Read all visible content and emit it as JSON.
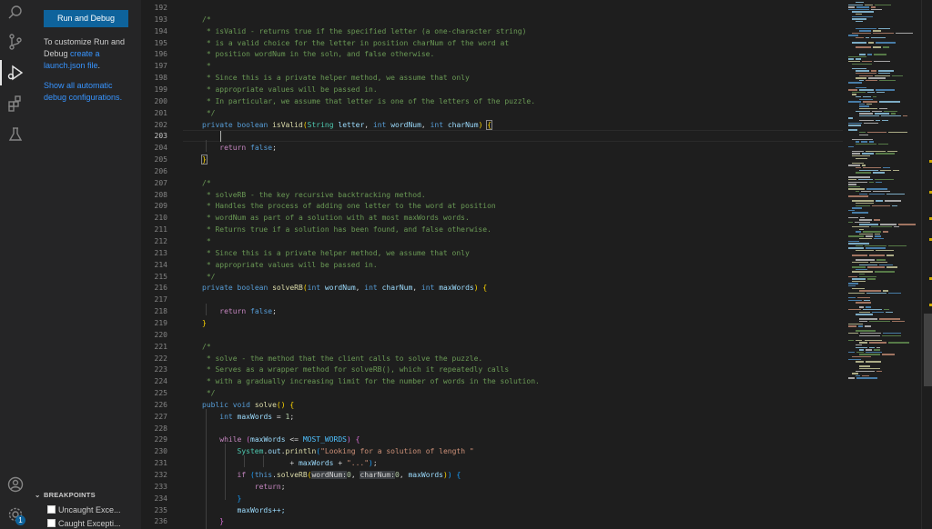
{
  "sidebar": {
    "run_button": "Run and Debug",
    "customize_text": "To customize Run and Debug ",
    "customize_link": "create a launch.json file",
    "customize_end": ".",
    "show_link": "Show all automatic debug configurations",
    "show_end": ".",
    "breakpoints_header": "BREAKPOINTS",
    "breakpoints": [
      {
        "label": "Uncaught Exce..."
      },
      {
        "label": "Caught Excepti..."
      }
    ]
  },
  "activity_bar": {
    "icons": [
      "search-icon",
      "source-control-icon",
      "run-debug-icon",
      "extensions-icon",
      "testing-icon",
      "account-icon",
      "settings-gear-icon"
    ],
    "settings_badge": "1"
  },
  "editor": {
    "colors": {
      "background": "#1e1e1e",
      "comment": "#6a9955",
      "keyword": "#569cd6"
    },
    "line_numbers": [
      "192",
      "193",
      "194",
      "195",
      "196",
      "197",
      "198",
      "199",
      "200",
      "201",
      "202",
      "203",
      "204",
      "205",
      "206",
      "207",
      "208",
      "209",
      "210",
      "211",
      "212",
      "213",
      "214",
      "215",
      "216",
      "217",
      "218",
      "219",
      "220",
      "221",
      "222",
      "223",
      "224",
      "225",
      "226",
      "227",
      "228",
      "229",
      "230",
      "231",
      "232",
      "233",
      "234",
      "235",
      "236"
    ],
    "current_line": "203",
    "text": {
      "c194": " * isValid - returns true if the specified letter (a one-character string)",
      "c195": " * is a valid choice for the letter in position charNum of the word at",
      "c196": " * position wordNum in the soln, and false otherwise.",
      "c197": " *",
      "c198": " * Since this is a private helper method, we assume that only",
      "c199": " * appropriate values will be passed in.",
      "c200": " * In particular, we assume that letter is one of the letters of the puzzle.",
      "c201": " */",
      "c208": " * solveRB - the key recursive backtracking method.",
      "c209": " * Handles the process of adding one letter to the word at position",
      "c210": " * wordNum as part of a solution with at most maxWords words.",
      "c211": " * Returns true if a solution has been found, and false otherwise.",
      "c212": " *",
      "c213": " * Since this is a private helper method, we assume that only",
      "c214": " * appropriate values will be passed in.",
      "c215": " */",
      "c222": " * solve - the method that the client calls to solve the puzzle.",
      "c223": " * Serves as a wrapper method for solveRB(), which it repeatedly calls",
      "c224": " * with a gradually increasing limit for the number of words in the solution.",
      "c225": " */",
      "open_comment": "/*",
      "kw_private": "private",
      "kw_boolean": "boolean",
      "fn_isValid": "isValid",
      "ty_String": "String",
      "p_letter": "letter",
      "kw_int": "int",
      "p_wordNum": "wordNum",
      "p_charNum": "charNum",
      "kw_return": "return",
      "kw_false": "false",
      "fn_solveRB": "solveRB",
      "p_maxWords": "maxWords",
      "kw_public": "public",
      "kw_void": "void",
      "fn_solve": "solve",
      "num_1": "1",
      "kw_while": "while",
      "cc_MOST": "MOST_WORDS",
      "ty_System": "System",
      "v_out": "out",
      "fn_println": "println",
      "s_looking": "\"Looking for a solution of length \"",
      "s_dots": "\"...\"",
      "kw_if": "if",
      "kw_this": "this",
      "hint_wordNum": "wordNum:",
      "hint_charNum": "charNum:",
      "num_0": "0",
      "inc": "maxWords++;"
    }
  }
}
